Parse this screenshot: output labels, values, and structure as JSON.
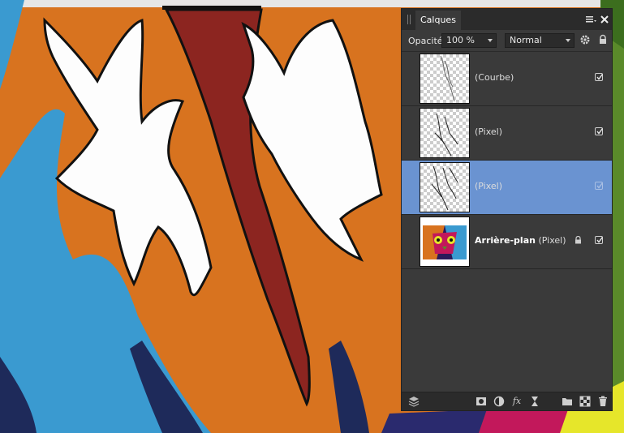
{
  "panel": {
    "tab_label": "Calques",
    "opacity_label": "Opacité:",
    "opacity_value": "100 %",
    "blend_mode": "Normal"
  },
  "layers": [
    {
      "name": "",
      "type": "(Courbe)",
      "visible": true,
      "selected": false,
      "locked": false
    },
    {
      "name": "",
      "type": "(Pixel)",
      "visible": true,
      "selected": false,
      "locked": false
    },
    {
      "name": "",
      "type": "(Pixel)",
      "visible": true,
      "selected": true,
      "locked": false
    },
    {
      "name": "Arrière-plan",
      "type": "(Pixel)",
      "visible": true,
      "selected": false,
      "locked": true
    }
  ],
  "icons": {
    "tab_menu": "menu-icon",
    "tab_close": "close-icon",
    "settings": "gear-icon",
    "lock": "lock-icon",
    "bottom": [
      "layers-stack-icon",
      "mask-icon",
      "adjustment-icon",
      "fx-icon",
      "hourglass-icon",
      "folder-icon",
      "checker-icon",
      "trash-icon"
    ]
  },
  "colors": {
    "canvas_orange": "#d8731f",
    "canvas_red": "#8c2520",
    "canvas_blue": "#3a9ad0",
    "selection": "#6a93d1",
    "panel_bg": "#3a3a3a"
  }
}
